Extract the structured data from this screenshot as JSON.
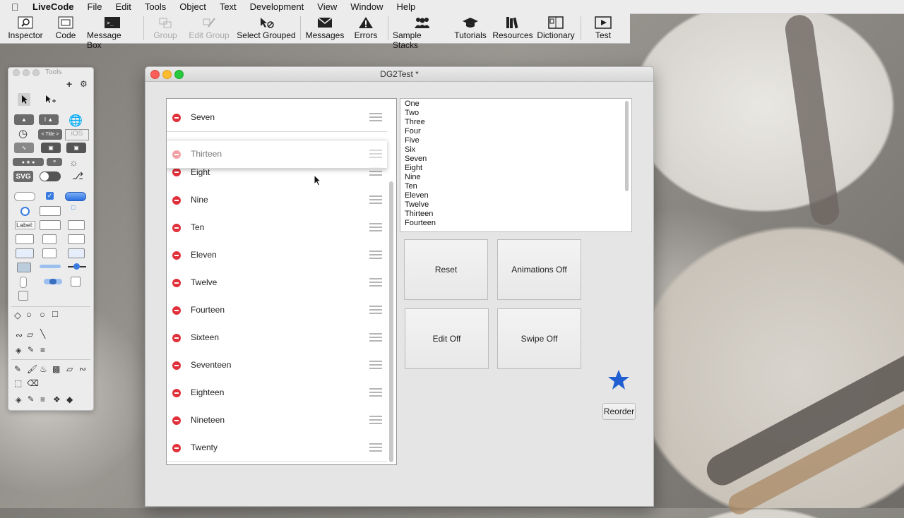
{
  "menubar": {
    "app": "LiveCode",
    "items": [
      "File",
      "Edit",
      "Tools",
      "Object",
      "Text",
      "Development",
      "View",
      "Window",
      "Help"
    ]
  },
  "toolbar": {
    "items": [
      {
        "label": "Inspector",
        "icon": "magnifier-icon",
        "enabled": true
      },
      {
        "label": "Code",
        "icon": "script-icon",
        "enabled": true
      },
      {
        "label": "Message Box",
        "icon": "terminal-icon",
        "enabled": true
      },
      {
        "label": "Group",
        "icon": "group-icon",
        "enabled": false
      },
      {
        "label": "Edit Group",
        "icon": "edit-group-icon",
        "enabled": false
      },
      {
        "label": "Select Grouped",
        "icon": "select-grouped-icon",
        "enabled": true
      },
      {
        "label": "Messages",
        "icon": "envelope-icon",
        "enabled": true
      },
      {
        "label": "Errors",
        "icon": "warning-icon",
        "enabled": true
      },
      {
        "label": "Sample Stacks",
        "icon": "people-icon",
        "enabled": true
      },
      {
        "label": "Tutorials",
        "icon": "graduation-cap-icon",
        "enabled": true
      },
      {
        "label": "Resources",
        "icon": "books-icon",
        "enabled": true
      },
      {
        "label": "Dictionary",
        "icon": "book-icon",
        "enabled": true
      },
      {
        "label": "Test",
        "icon": "play-icon",
        "enabled": true
      }
    ]
  },
  "tools_palette": {
    "title": "Tools",
    "label_widget_text": "Label:",
    "svg_widget_text": "SVG",
    "title_widget_text": "< Title >",
    "ios_text": "iOS"
  },
  "window": {
    "title": "DG2Test *",
    "datagrid": {
      "top_partial": "Seven",
      "dragging": "Thirteen",
      "rows": [
        "Eight",
        "Nine",
        "Ten",
        "Eleven",
        "Twelve",
        "Fourteen",
        "Sixteen",
        "Seventeen",
        "Eighteen",
        "Nineteen",
        "Twenty"
      ]
    },
    "field_lines": [
      "One",
      "Two",
      "Three",
      "Four",
      "Five",
      "Six",
      "Seven",
      "Eight",
      "Nine",
      "Ten",
      "Eleven",
      "Twelve",
      "Thirteen",
      "Fourteen"
    ],
    "buttons": {
      "reset": "Reset",
      "animations": "Animations Off",
      "edit": "Edit Off",
      "swipe": "Swipe Off",
      "reorder": "Reorder"
    },
    "colors": {
      "delete": "#e0303a",
      "star": "#1f5fd1"
    }
  }
}
